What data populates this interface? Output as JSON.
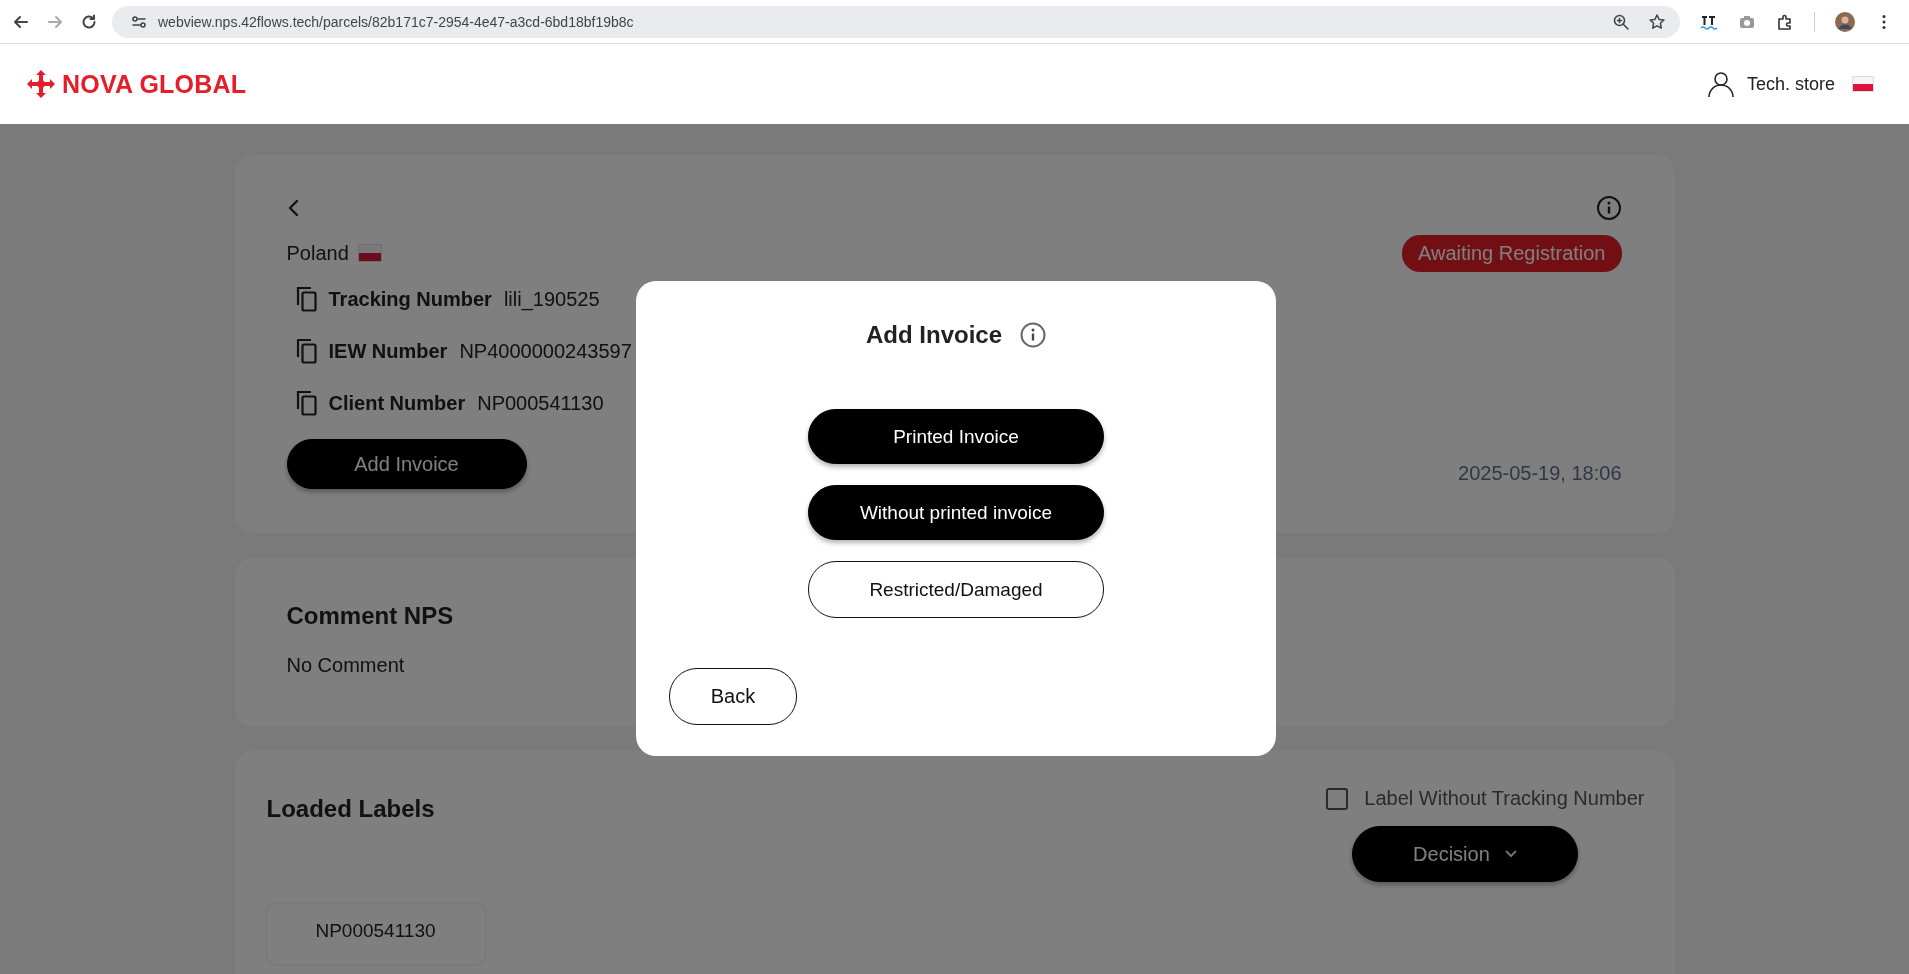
{
  "browser": {
    "url": "webview.nps.42flows.tech/parcels/82b171c7-2954-4e47-a3cd-6bd18bf19b8c"
  },
  "header": {
    "logo": "NOVA GLOBAL",
    "user": "Tech. store"
  },
  "parcel": {
    "country": "Poland",
    "status": "Awaiting Registration",
    "fields": [
      {
        "label": "Tracking Number",
        "value": "lili_190525"
      },
      {
        "label": "IEW Number",
        "value": "NP4000000243597"
      },
      {
        "label": "Client Number",
        "value": "NP000541130"
      }
    ],
    "action": "Add Invoice",
    "date": "2025-05-19, 18:06"
  },
  "comment": {
    "title": "Comment NPS",
    "text": "No Comment"
  },
  "labels": {
    "title": "Loaded Labels",
    "checkbox": {
      "label": "Label Without Tracking Number",
      "checked": false
    },
    "decision": "Decision",
    "items": [
      "NP000541130"
    ]
  },
  "modal": {
    "title": "Add Invoice",
    "options": [
      {
        "label": "Printed Invoice",
        "kind": "filled"
      },
      {
        "label": "Without printed invoice",
        "kind": "filled"
      },
      {
        "label": "Restricted/Damaged",
        "kind": "outlined"
      }
    ],
    "back": "Back"
  }
}
